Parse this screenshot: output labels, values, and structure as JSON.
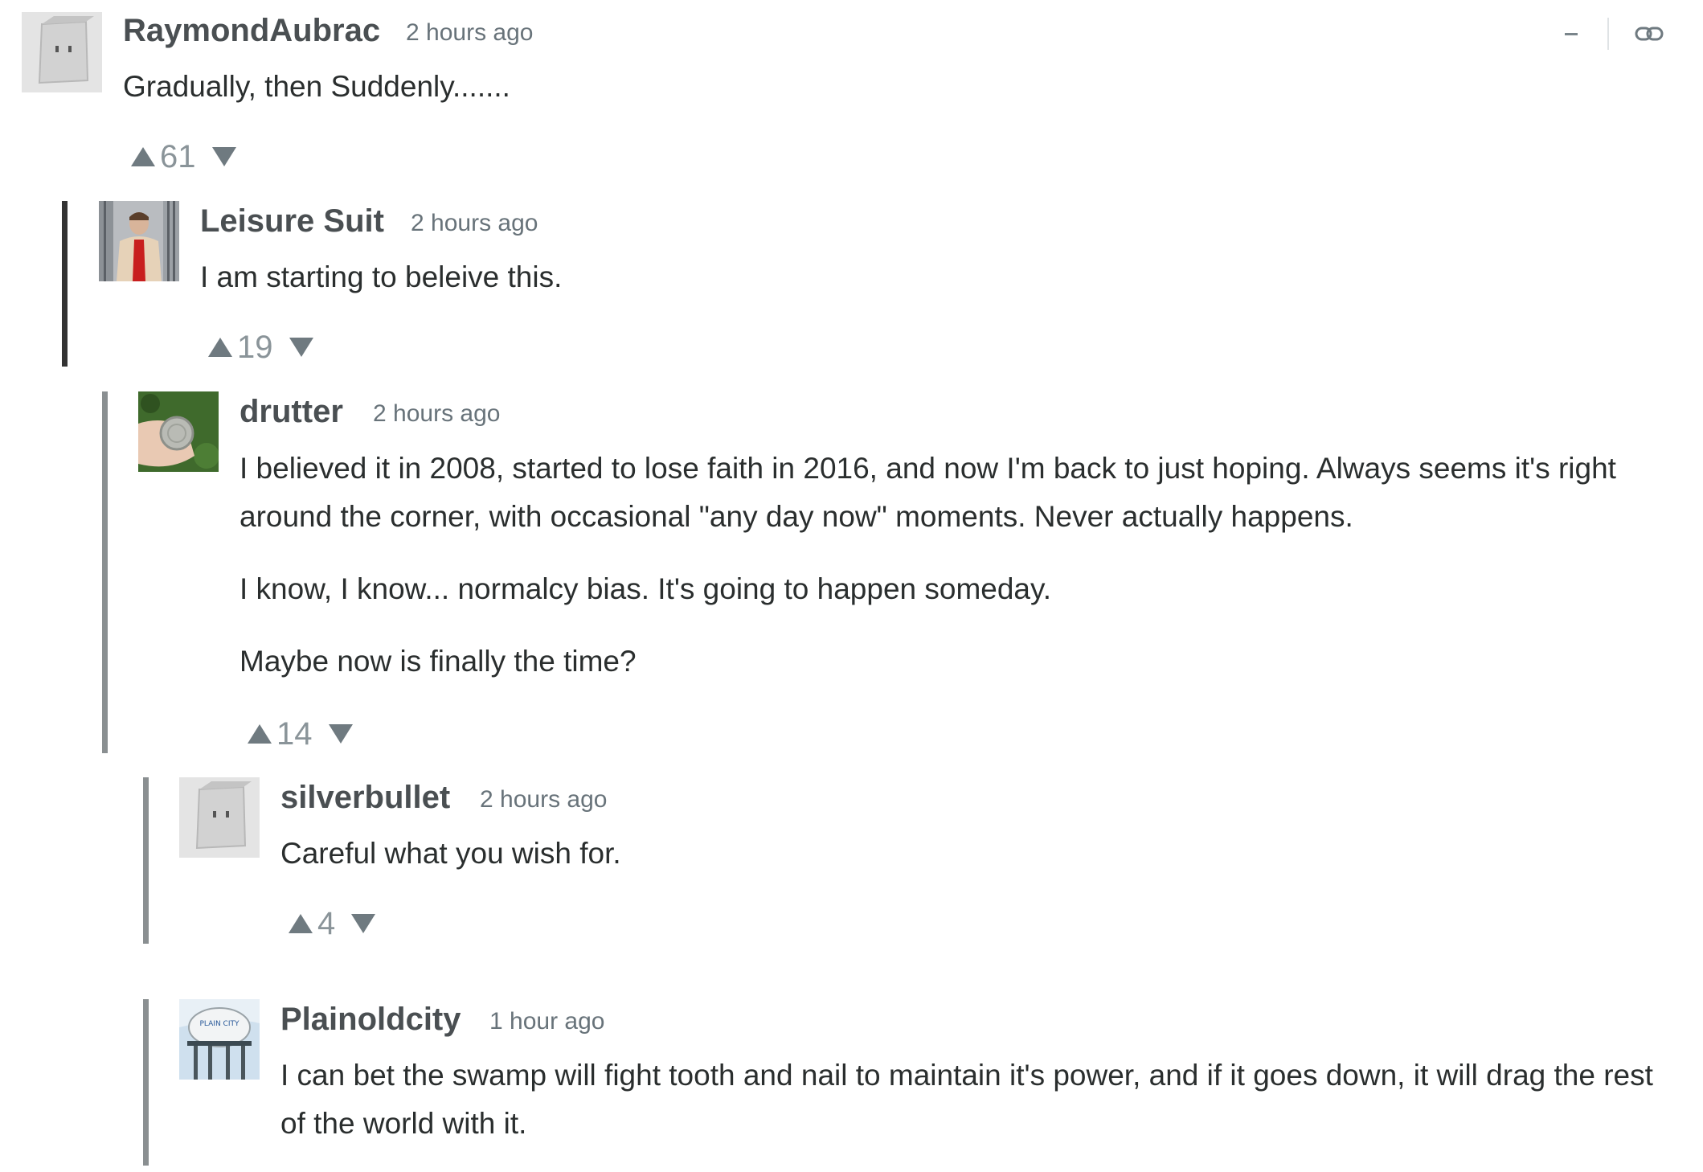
{
  "controls": {
    "collapse_icon": "minus-icon",
    "link_icon": "chain-link-icon"
  },
  "colors": {
    "thread_bar_1": "#333333",
    "thread_bar_other": "#8a8f91",
    "vote_arrow": "#6f7a80"
  },
  "comments": [
    {
      "author": "RaymondAubrac",
      "time": "2 hours ago",
      "body": [
        "Gradually, then Suddenly......."
      ],
      "votes": "61",
      "avatar": "paper-bag-avatar"
    },
    {
      "author": "Leisure Suit",
      "time": "2 hours ago",
      "body": [
        "I am starting to beleive this."
      ],
      "votes": "19",
      "avatar": "man-in-suit-avatar"
    },
    {
      "author": "drutter",
      "time": "2 hours ago",
      "body": [
        "I believed it in 2008, started to lose faith in 2016, and now I'm back to just hoping. Always seems it's right around the corner, with occasional \"any day now\" moments. Never actually happens.",
        "I know, I know... normalcy bias. It's going to happen someday.",
        "Maybe now is finally the time?"
      ],
      "votes": "14",
      "avatar": "hand-holding-coin-avatar"
    },
    {
      "author": "silverbullet",
      "time": "2 hours ago",
      "body": [
        "Careful what you wish for."
      ],
      "votes": "4",
      "avatar": "paper-bag-avatar"
    },
    {
      "author": "Plainoldcity",
      "time": "1 hour ago",
      "body": [
        "I can bet the swamp will fight tooth and nail to maintain it's power, and if it goes down, it will drag the rest of the world with it."
      ],
      "votes": "",
      "avatar": "water-tower-avatar",
      "avatar_text": "PLAIN CITY"
    }
  ]
}
